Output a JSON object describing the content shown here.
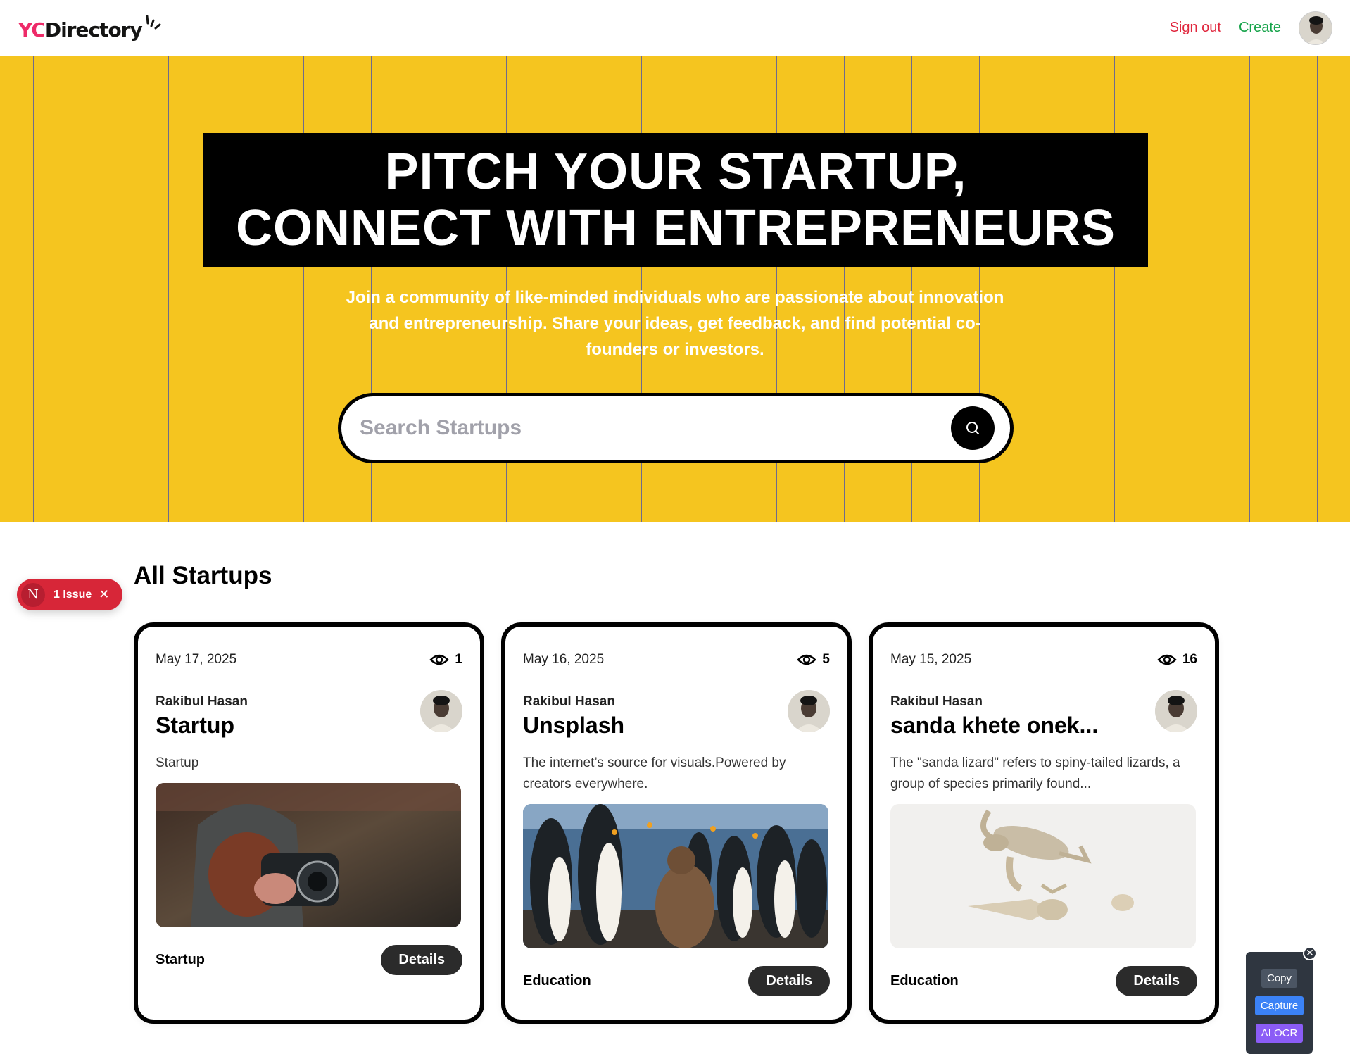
{
  "navbar": {
    "logo_yc": "YC",
    "logo_directory": "Directory",
    "signout_label": "Sign out",
    "create_label": "Create"
  },
  "hero": {
    "title_line1": "PITCH YOUR STARTUP,",
    "title_line2": "CONNECT WITH ENTREPRENEURS",
    "subtitle": "Join a community of like-minded individuals who are passionate about innovation and entrepreneurship. Share your ideas, get feedback, and find potential co-founders or investors.",
    "search_placeholder": "Search Startups"
  },
  "section": {
    "title": "All Startups"
  },
  "issue_badge": {
    "letter": "N",
    "text": "1 Issue"
  },
  "cards": [
    {
      "date": "May 17, 2025",
      "views": "1",
      "author": "Rakibul Hasan",
      "title": "Startup",
      "description": "Startup",
      "category": "Startup",
      "details_label": "Details"
    },
    {
      "date": "May 16, 2025",
      "views": "5",
      "author": "Rakibul Hasan",
      "title": "Unsplash",
      "description": "The internet’s source for visuals.Powered by creators everywhere.",
      "category": "Education",
      "details_label": "Details"
    },
    {
      "date": "May 15, 2025",
      "views": "16",
      "author": "Rakibul Hasan",
      "title": "sanda khete onek...",
      "description": "The \"sanda lizard\" refers to spiny-tailed lizards, a group of species primarily found...",
      "category": "Education",
      "details_label": "Details"
    }
  ],
  "tools": {
    "copy": "Copy",
    "capture": "Capture",
    "ocr": "AI OCR"
  },
  "colors": {
    "hero_bg": "#f5c51f",
    "brand_pink": "#ee2b69",
    "signout_red": "#e0263d",
    "create_green": "#16a34a"
  }
}
